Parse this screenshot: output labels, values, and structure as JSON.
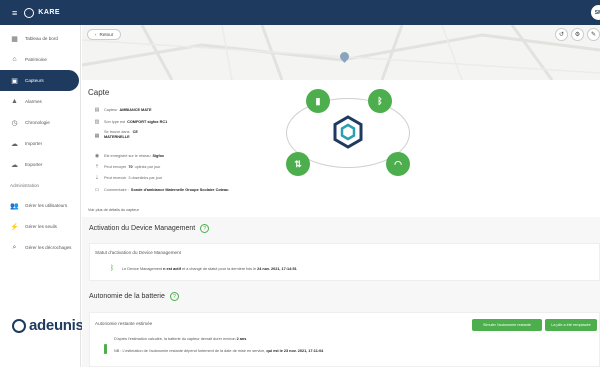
{
  "app": {
    "menu_icon": "hamburger-icon",
    "brand": "KARE",
    "user_initials": "SM"
  },
  "sidebar": {
    "items": [
      {
        "label": "Tableau de bord",
        "icon": "dashboard-icon"
      },
      {
        "label": "Patrimoine",
        "icon": "building-icon"
      },
      {
        "label": "Capteurs",
        "icon": "sensor-icon",
        "active": true
      },
      {
        "label": "Alarmes",
        "icon": "bell-icon"
      },
      {
        "label": "Chronologie",
        "icon": "clock-icon"
      },
      {
        "label": "Importer",
        "icon": "cloud-upload-icon"
      },
      {
        "label": "Exporter",
        "icon": "cloud-download-icon"
      }
    ],
    "admin_section": "Administration",
    "admin_items": [
      {
        "label": "Gérer les utilisateurs",
        "icon": "users-icon"
      },
      {
        "label": "Gérer les seuils",
        "icon": "threshold-icon"
      },
      {
        "label": "Gérer les décrochages",
        "icon": "search-icon"
      }
    ],
    "logo": "adeunis"
  },
  "map": {
    "back_label": "Retour",
    "tools": [
      "history-icon",
      "gear-icon",
      "pencil-icon"
    ]
  },
  "capteur": {
    "title": "Capte",
    "fields": [
      {
        "icon": "tag-icon",
        "label": "Capteur",
        "value": "AMBIANCE MATE"
      },
      {
        "icon": "chip-icon",
        "label": "Son type est",
        "value": "COMFORT sigfox RC1"
      },
      {
        "icon": "building-icon",
        "label": "Se trouve dans",
        "value": "CE",
        "sub": "MATERNELLE"
      },
      {
        "icon": "signal-icon",
        "label": "Est enregistré sur le réseau",
        "value": "Sigfox"
      },
      {
        "icon": "upload-icon",
        "label": "Peut envoyer",
        "value": "70",
        "suffix": "uplinks par jour"
      },
      {
        "icon": "download-icon",
        "label": "Peut recevoir",
        "value": "",
        "suffix": "3 downlinks par jour"
      },
      {
        "icon": "comment-icon",
        "label": "Commentaire :",
        "value": "Sonde d'ambiance Maternelle Groupe Scolaire Coteau"
      }
    ],
    "voir_plus": "Voir plus de détails du capteur"
  },
  "device_management": {
    "title": "Activation du Device Management",
    "status_head": "Statut d'activation du Device Management",
    "line_prefix": "Le Device Management",
    "line_status": "n est actif",
    "line_mid": "et a changé de statut pour la dernière fois le",
    "line_date": "24 nov. 2021, 17:14:51"
  },
  "battery": {
    "title": "Autonomie de la batterie",
    "estimated_head": "Autonomie restante estimée",
    "btn_simulate": "Simuler l'autonomie restante",
    "btn_replaced": "La pile a été remplacée",
    "line1_prefix": "D'après l'estimation calculée, la batterie du capteur devrait durer environ",
    "line1_value": "2 ans",
    "line2_prefix": "NB : L'estimation de l'autonomie restante dépend fortement de la date de mise en service,",
    "line2_bold": "qui est le 23 nov. 2021, 17:11:04",
    "level": 0.85
  },
  "colors": {
    "primary": "#1e3a5f",
    "accent": "#4cae4c"
  }
}
